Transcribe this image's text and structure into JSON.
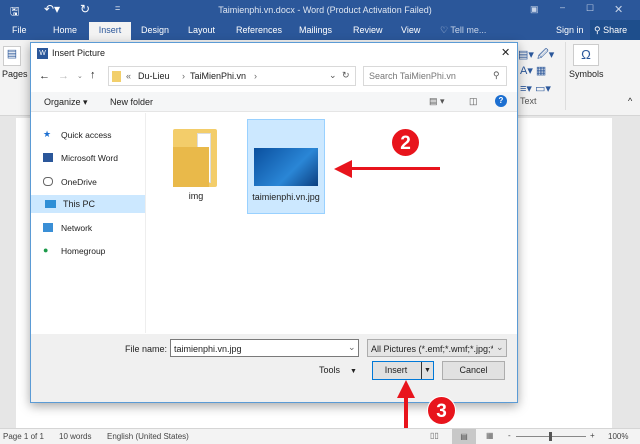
{
  "app": {
    "title": "Taimienphi.vn.docx - Word (Product Activation Failed)"
  },
  "tabs": [
    "File",
    "Home",
    "Insert",
    "Design",
    "Layout",
    "References",
    "Mailings",
    "Review",
    "View"
  ],
  "tell_me": "Tell me...",
  "sign_in": "Sign in",
  "share": "Share",
  "ribbon": {
    "pages": "Pages",
    "symbols": "Symbols",
    "text_group": "Text"
  },
  "dialog": {
    "title": "Insert Picture",
    "breadcrumb": [
      "«",
      "Du-Lieu",
      "TaiMienPhi.vn"
    ],
    "search_placeholder": "Search TaiMienPhi.vn",
    "organize": "Organize ▾",
    "new_folder": "New folder",
    "nav": [
      "Quick access",
      "Microsoft Word",
      "OneDrive",
      "This PC",
      "Network",
      "Homegroup"
    ],
    "files": [
      {
        "name": "img",
        "type": "folder"
      },
      {
        "name": "taimienphi.vn.jpg",
        "type": "image"
      }
    ],
    "file_name_label": "File name:",
    "file_name_value": "taimienphi.vn.jpg",
    "filter": "All Pictures (*.emf;*.wmf;*.jpg;*",
    "tools": "Tools",
    "insert": "Insert",
    "cancel": "Cancel"
  },
  "annotations": {
    "step2": "2",
    "step3": "3",
    "accent": "#e8141c"
  },
  "status": {
    "page": "Page 1 of 1",
    "words": "10 words",
    "language": "English (United States)",
    "zoom": "100%"
  }
}
